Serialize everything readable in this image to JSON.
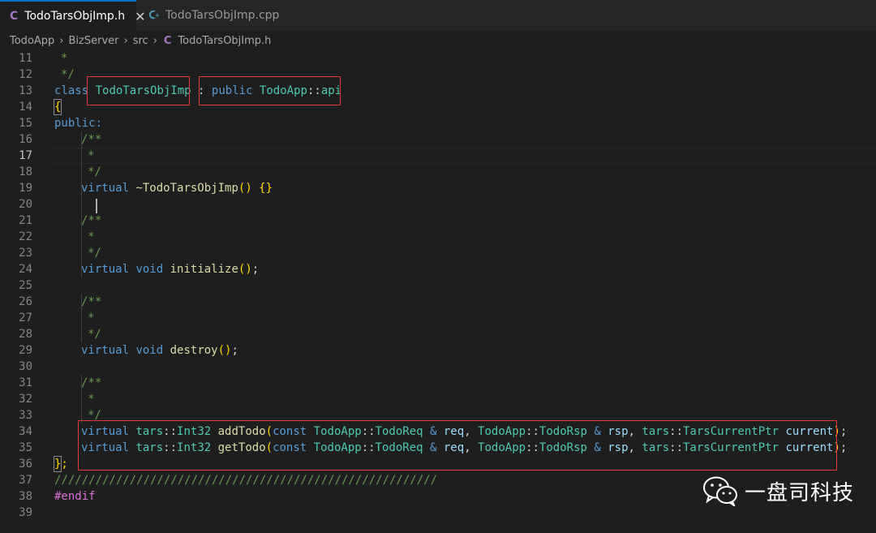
{
  "tabs": [
    {
      "label": "TodoTarsObjImp.h",
      "icon": "c-header-icon",
      "active": true,
      "close": "✕"
    },
    {
      "label": "TodoTarsObjImp.cpp",
      "icon": "cpp-file-icon",
      "active": false
    }
  ],
  "breadcrumb": {
    "items": [
      "TodoApp",
      "BizServer",
      "src"
    ],
    "file_icon": "C",
    "file": "TodoTarsObjImp.h"
  },
  "editor": {
    "current_line": "17",
    "lines": [
      {
        "n": "11"
      },
      {
        "n": "12"
      },
      {
        "n": "13"
      },
      {
        "n": "14"
      },
      {
        "n": "15"
      },
      {
        "n": "16"
      },
      {
        "n": "17"
      },
      {
        "n": "18"
      },
      {
        "n": "19"
      },
      {
        "n": "20"
      },
      {
        "n": "21"
      },
      {
        "n": "22"
      },
      {
        "n": "23"
      },
      {
        "n": "24"
      },
      {
        "n": "25"
      },
      {
        "n": "26"
      },
      {
        "n": "27"
      },
      {
        "n": "28"
      },
      {
        "n": "29"
      },
      {
        "n": "30"
      },
      {
        "n": "31"
      },
      {
        "n": "32"
      },
      {
        "n": "33"
      },
      {
        "n": "34"
      },
      {
        "n": "35"
      },
      {
        "n": "36"
      },
      {
        "n": "37"
      },
      {
        "n": "38"
      },
      {
        "n": "39"
      }
    ],
    "tokens": {
      "star": "*",
      "close_comment": "*/",
      "open_comment": "/**",
      "class_kw": "class",
      "class_name": "TodoTarsObjImp",
      "colon": ":",
      "public_kw": "public",
      "base_ns": "TodoApp",
      "scope": "::",
      "base_name": "api",
      "open_brace": "{",
      "public_label": "public:",
      "virtual_kw": "virtual",
      "destructor": "~TodoTarsObjImp",
      "destructor_rest": "() {}",
      "void_kw": "void",
      "initialize": "initialize",
      "destroy": "destroy",
      "call_parens": "()",
      "semicolon": ";",
      "tars_ns": "tars",
      "int32": "Int32",
      "addTodo": "addTodo",
      "getTodo": "getTodo",
      "const_kw": "const",
      "todo_ns": "TodoApp",
      "todo_req": "TodoReq",
      "todo_rsp": "TodoRsp",
      "amp": "&",
      "req": "req",
      "rsp": "rsp",
      "comma": ",",
      "current_ptr": "TarsCurrentPtr",
      "current": "current",
      "close_class": "};",
      "slashes": "////////////////////////////////////////////////////////",
      "endif": "#endif"
    }
  },
  "watermark": {
    "text": "一盘司科技",
    "icon": "wechat-icon"
  },
  "colors": {
    "highlight_box": "#e03a3a",
    "keyword": "#569cd6",
    "type": "#4ec9b0",
    "function": "#dcdcaa",
    "variable": "#9cdcfe",
    "comment": "#6a9955"
  }
}
